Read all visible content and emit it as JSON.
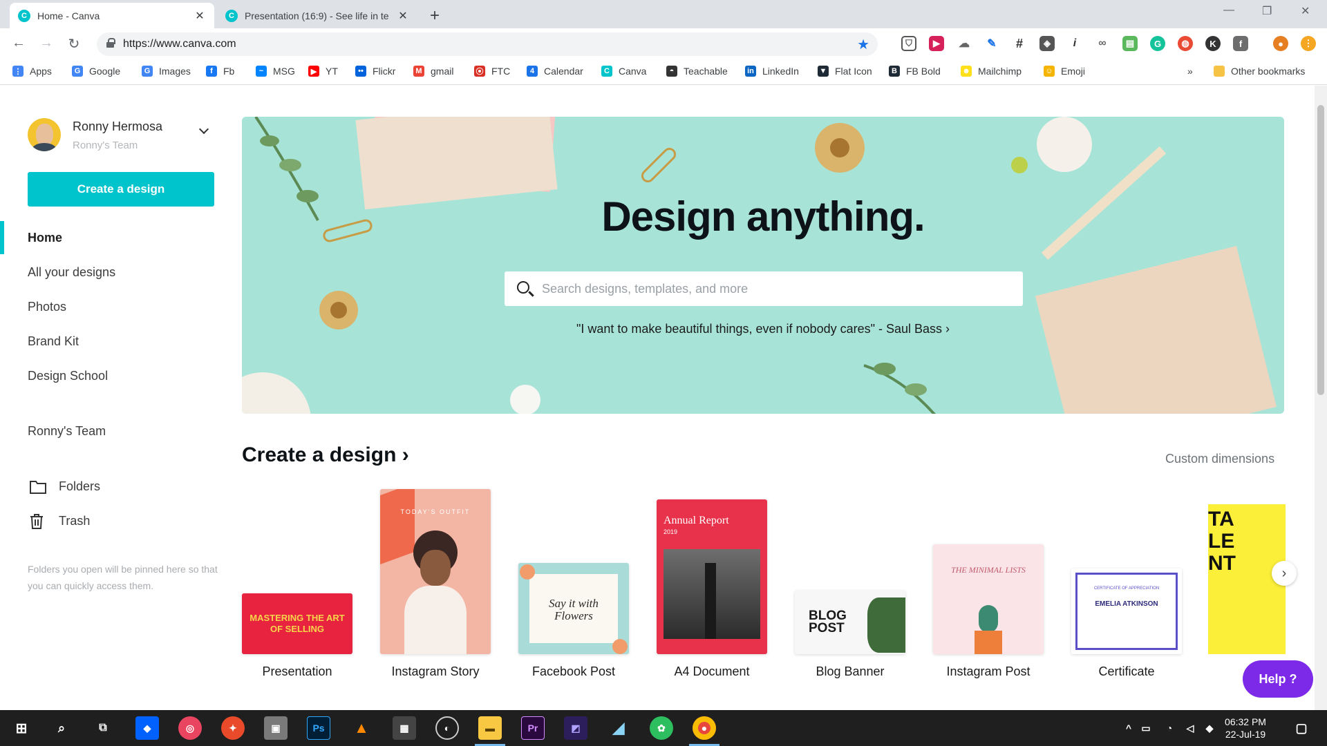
{
  "browser": {
    "tabs": [
      {
        "title": "Home - Canva",
        "favicon": "canva-icon",
        "active": true
      },
      {
        "title": "Presentation (16:9) - See life in te",
        "favicon": "canva-icon",
        "active": false
      }
    ],
    "url": "https://www.canva.com",
    "bookmarks": [
      {
        "label": "Apps",
        "icon": "apps-grid-icon",
        "color": "#4285f4"
      },
      {
        "label": "Google",
        "icon": "google-icon",
        "color": "#4285f4"
      },
      {
        "label": "Images",
        "icon": "google-icon",
        "color": "#4285f4"
      },
      {
        "label": "Fb",
        "icon": "facebook-icon",
        "color": "#1877f2"
      },
      {
        "label": "MSG",
        "icon": "messenger-icon",
        "color": "#0084ff"
      },
      {
        "label": "YT",
        "icon": "youtube-icon",
        "color": "#ff0000"
      },
      {
        "label": "Flickr",
        "icon": "flickr-icon",
        "color": "#0063dc"
      },
      {
        "label": "gmail",
        "icon": "gmail-icon",
        "color": "#ea4335"
      },
      {
        "label": "FTC",
        "icon": "ftc-icon",
        "color": "#d93025"
      },
      {
        "label": "Calendar",
        "icon": "calendar-icon",
        "color": "#1a73e8"
      },
      {
        "label": "Canva",
        "icon": "canva-icon",
        "color": "#00c4cc"
      },
      {
        "label": "Teachable",
        "icon": "teachable-icon",
        "color": "#333333"
      },
      {
        "label": "LinkedIn",
        "icon": "linkedin-icon",
        "color": "#0a66c2"
      },
      {
        "label": "Flat Icon",
        "icon": "flaticon-icon",
        "color": "#1f2a37"
      },
      {
        "label": "FB Bold",
        "icon": "fb-bold-icon",
        "color": "#1f2a37"
      },
      {
        "label": "Mailchimp",
        "icon": "mailchimp-icon",
        "color": "#ffe01b"
      },
      {
        "label": "Emoji",
        "icon": "emoji-icon",
        "color": "#f4b400"
      }
    ],
    "more_bookmarks": "»",
    "other_bookmarks": "Other bookmarks"
  },
  "user": {
    "name": "Ronny Hermosa",
    "team": "Ronny's Team"
  },
  "sidebar": {
    "create_button": "Create a design",
    "nav": [
      "Home",
      "All your designs",
      "Photos",
      "Brand Kit",
      "Design School"
    ],
    "team_link": "Ronny's Team",
    "folders": "Folders",
    "trash": "Trash",
    "note": "Folders you open will be pinned here so that you can quickly access them."
  },
  "hero": {
    "title": "Design anything.",
    "search_placeholder": "Search designs, templates, and more",
    "quote": "\"I want to make beautiful things, even if nobody cares\" - Saul Bass ›",
    "bg_color": "#a7e4d7"
  },
  "create": {
    "title": "Create a design ›",
    "custom_dimensions": "Custom dimensions",
    "items": [
      {
        "label": "Presentation",
        "thumb_text": "MASTERING THE ART OF SELLING"
      },
      {
        "label": "Instagram Story",
        "thumb_text": "TODAY'S OUTFIT"
      },
      {
        "label": "Facebook Post",
        "thumb_text": "Say it with Flowers"
      },
      {
        "label": "A4 Document",
        "thumb_text": "Annual Report",
        "thumb_sub": "2019"
      },
      {
        "label": "Blog Banner",
        "thumb_text": "BLOG POST"
      },
      {
        "label": "Instagram Post",
        "thumb_text": "THE MINIMAL LISTS"
      },
      {
        "label": "Certificate",
        "thumb_text": "EMELIA ATKINSON",
        "thumb_sub": "CERTIFICATE OF APPRECIATION"
      },
      {
        "label": "",
        "thumb_text": "TA LE NT"
      }
    ]
  },
  "help": {
    "label": "Help ?"
  },
  "taskbar": {
    "time": "06:32 PM",
    "date": "22-Jul-19"
  },
  "colors": {
    "accent": "#00c4cc",
    "help": "#7d2ae8"
  }
}
